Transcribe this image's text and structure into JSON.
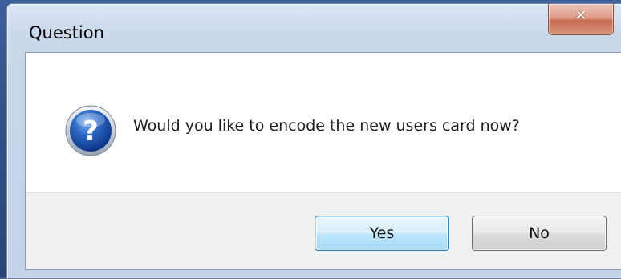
{
  "dialog": {
    "title": "Question",
    "close_icon": "close-icon",
    "message_icon": "question-icon",
    "message": "Would you like to encode the new users card now?",
    "buttons": {
      "yes": "Yes",
      "no": "No"
    }
  },
  "colors": {
    "close_button": "#d9826b",
    "default_button_border": "#3c7fb1",
    "icon_blue": "#1e55b0"
  }
}
